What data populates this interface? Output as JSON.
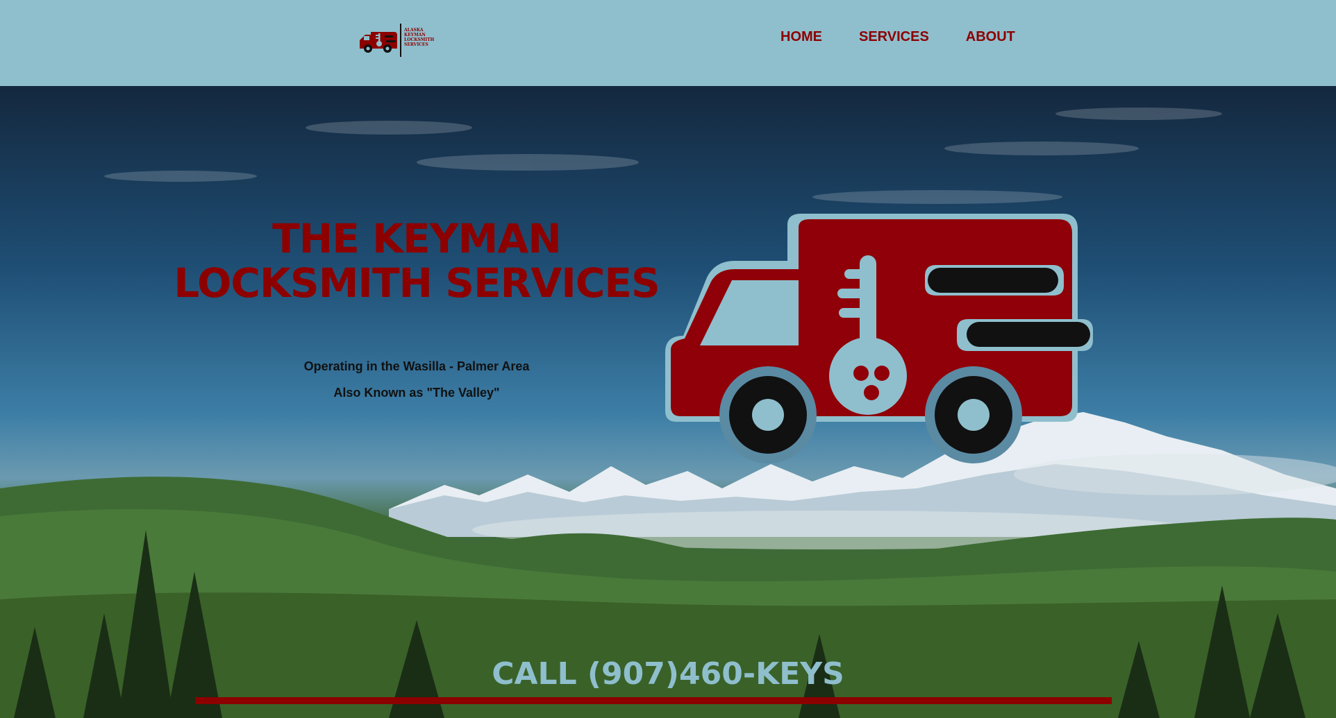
{
  "header": {
    "logo": {
      "icon": "truck-key-icon",
      "lines": [
        "ALASKA",
        "KEYMAN",
        "LOCKSMITH",
        "SERVICES"
      ]
    },
    "nav": [
      {
        "label": "HOME"
      },
      {
        "label": "SERVICES"
      },
      {
        "label": "ABOUT"
      }
    ]
  },
  "hero": {
    "title_line1": "THE KEYMAN",
    "title_line2": "LOCKSMITH SERVICES",
    "subtitle1": "Operating in the Wasilla - Palmer Area",
    "subtitle2": "Also Known as \"The Valley\"",
    "illustration": "truck-key-icon",
    "call_text": "CALL (907)460-KEYS"
  },
  "colors": {
    "header_bg": "#8fbfcd",
    "brand_red": "#8c0000",
    "truck_red": "#8f0008",
    "accent_blue": "#8fbfcd",
    "text_dark": "#111111"
  }
}
